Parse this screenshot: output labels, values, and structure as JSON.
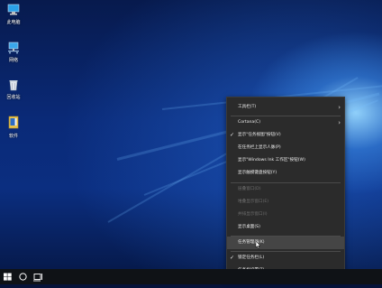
{
  "desktop": {
    "icons": [
      {
        "label": "此电脑",
        "icon": "computer-icon"
      },
      {
        "label": "网络",
        "icon": "network-icon"
      },
      {
        "label": "回收站",
        "icon": "recycle-bin-icon"
      },
      {
        "label": "软件",
        "icon": "folder-icon"
      }
    ]
  },
  "menu": {
    "items": [
      {
        "label": "工具栏(T)"
      },
      {
        "label": "Cortana(C)"
      },
      {
        "label": "显示\"任务视图\"按钮(V)"
      },
      {
        "label": "在任务栏上显示人脉(P)"
      },
      {
        "label": "显示\"Windows Ink 工作区\"按钮(W)"
      },
      {
        "label": "显示触摸键盘按钮(Y)"
      },
      {
        "label": "层叠窗口(D)"
      },
      {
        "label": "堆叠显示窗口(E)"
      },
      {
        "label": "并排显示窗口(I)"
      },
      {
        "label": "显示桌面(S)"
      },
      {
        "label": "任务管理器(K)"
      },
      {
        "label": "锁定任务栏(L)"
      },
      {
        "label": "任务栏设置(T)"
      }
    ]
  },
  "taskbar": {
    "start_icon": "windows-logo-icon",
    "search_icon": "cortana-circle-icon",
    "taskview_icon": "task-view-icon"
  },
  "colors": {
    "menu_bg": "#2b2b2b",
    "menu_hover": "#454545",
    "taskbar_bg": "#0f1216",
    "desktop_accent": "#0a2a78"
  }
}
